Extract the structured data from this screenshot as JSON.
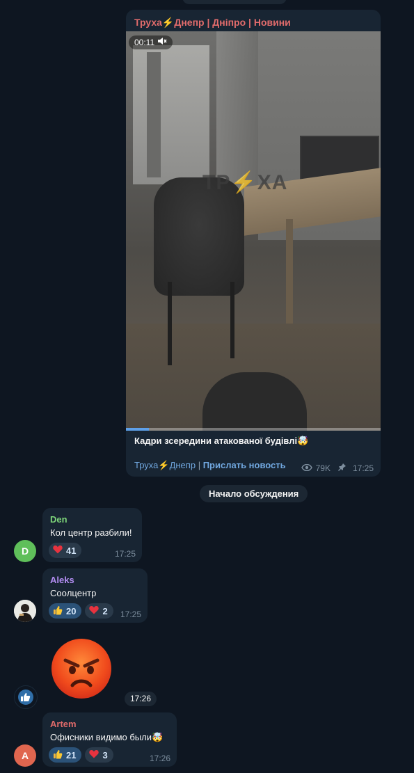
{
  "post": {
    "channel_title": "Труха⚡Днепр | Дніпро | Новини",
    "video_time": "00:11",
    "watermark": "ТР⚡ХА",
    "caption": "Кадри зсередини атакованої будівлі🤯",
    "footer_link1": "Труха⚡Днепр",
    "footer_sep": "|",
    "footer_link2": "Прислать новость",
    "views": "79K",
    "time": "17:25",
    "progress": 0.09
  },
  "discussion_label": "Начало обсуждения",
  "messages": [
    {
      "name": "Den",
      "name_color": "#7ed67a",
      "text": "Кол центр разбили!",
      "reactions": [
        {
          "emoji": "❤️",
          "count": "41"
        }
      ],
      "time": "17:25",
      "avatar_letter": "D",
      "avatar_color": "#5fbf5a"
    },
    {
      "name": "Aleks",
      "name_color": "#b18cf0",
      "text": "Cooлцентр",
      "reactions": [
        {
          "emoji": "👍",
          "count": "20"
        },
        {
          "emoji": "❤️",
          "count": "2"
        }
      ],
      "time": "17:25"
    },
    {
      "sticker": "😡",
      "time": "17:26"
    },
    {
      "name": "Artem",
      "name_color": "#e06a6a",
      "text": "Офисники видимо были🤯",
      "reactions": [
        {
          "emoji": "👍",
          "count": "21"
        },
        {
          "emoji": "❤️",
          "count": "3"
        }
      ],
      "time": "17:26",
      "avatar_letter": "A",
      "avatar_color": "#e0664f"
    }
  ],
  "icons": [
    "mute-icon",
    "eye-icon",
    "pin-icon",
    "thumbs-up-icon",
    "heart-icon"
  ],
  "colors": {
    "background": "#0e1621",
    "bubble": "#182533",
    "link": "#71a8e0",
    "channel": "#e26c6c"
  }
}
